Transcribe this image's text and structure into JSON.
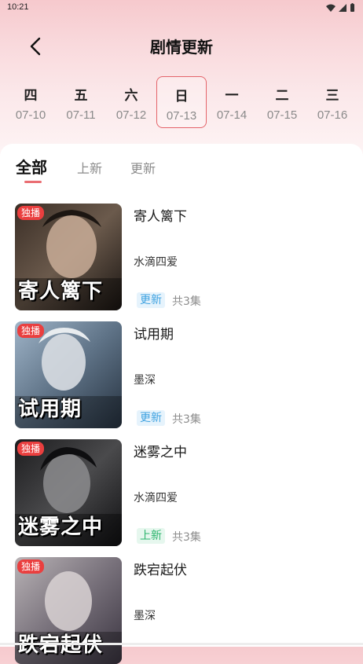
{
  "status_bar": {
    "time": "10:21"
  },
  "header": {
    "title": "剧情更新"
  },
  "days": [
    {
      "weekday": "四",
      "date": "07-10",
      "selected": false
    },
    {
      "weekday": "五",
      "date": "07-11",
      "selected": false
    },
    {
      "weekday": "六",
      "date": "07-12",
      "selected": false
    },
    {
      "weekday": "日",
      "date": "07-13",
      "selected": true
    },
    {
      "weekday": "一",
      "date": "07-14",
      "selected": false
    },
    {
      "weekday": "二",
      "date": "07-15",
      "selected": false
    },
    {
      "weekday": "三",
      "date": "07-16",
      "selected": false
    }
  ],
  "tabs": [
    {
      "label": "全部",
      "active": true
    },
    {
      "label": "上新",
      "active": false
    },
    {
      "label": "更新",
      "active": false
    }
  ],
  "colors": {
    "accent": "#ea6d72",
    "update_tag": "#3fa2e0",
    "new_tag": "#2bb46c",
    "badge": "#ea3f3f"
  },
  "items": [
    {
      "badge": "独播",
      "cover_text": "寄人篱下",
      "title": "寄人篱下",
      "author": "水滴四爱",
      "status": "更新",
      "status_type": "update",
      "episodes": "共3集"
    },
    {
      "badge": "独播",
      "cover_text": "试用期",
      "title": "试用期",
      "author": "墨深",
      "status": "更新",
      "status_type": "update",
      "episodes": "共3集"
    },
    {
      "badge": "独播",
      "cover_text": "迷雾之中",
      "title": "迷雾之中",
      "author": "水滴四爱",
      "status": "上新",
      "status_type": "new",
      "episodes": "共3集"
    },
    {
      "badge": "独播",
      "cover_text": "跌宕起伏",
      "title": "跌宕起伏",
      "author": "墨深",
      "status": "",
      "status_type": "",
      "episodes": ""
    }
  ]
}
